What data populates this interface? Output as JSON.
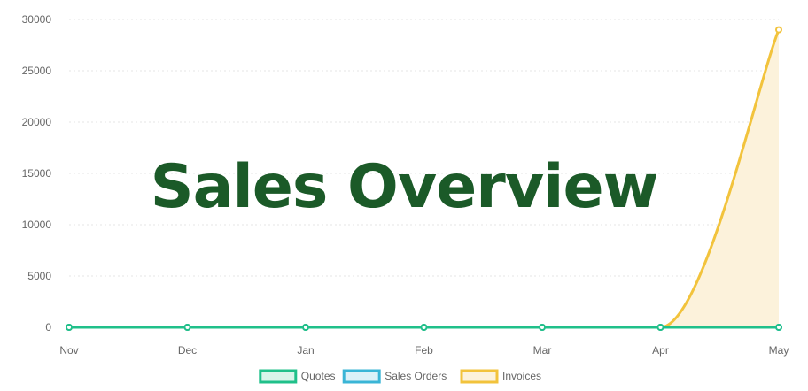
{
  "chart_data": {
    "type": "area",
    "title": "Sales Overview",
    "categories": [
      "Nov",
      "Dec",
      "Jan",
      "Feb",
      "Mar",
      "Apr",
      "May"
    ],
    "ylim": [
      0,
      30000
    ],
    "y_ticks": [
      "30000",
      "25000",
      "20000",
      "15000",
      "10000",
      "5000",
      "0"
    ],
    "grid": true,
    "legend_position": "bottom",
    "series": [
      {
        "name": "Quotes",
        "values": [
          0,
          0,
          0,
          0,
          0,
          0,
          0
        ],
        "color": "#20c08a",
        "fill": "#d8f5ea"
      },
      {
        "name": "Sales Orders",
        "values": [
          0,
          0,
          0,
          0,
          0,
          0,
          0
        ],
        "color": "#3ab5d6",
        "fill": "#dcf1f8"
      },
      {
        "name": "Invoices",
        "values": [
          0,
          0,
          0,
          0,
          0,
          0,
          29000
        ],
        "color": "#f2c33c",
        "fill": "#fcf2db"
      }
    ]
  }
}
